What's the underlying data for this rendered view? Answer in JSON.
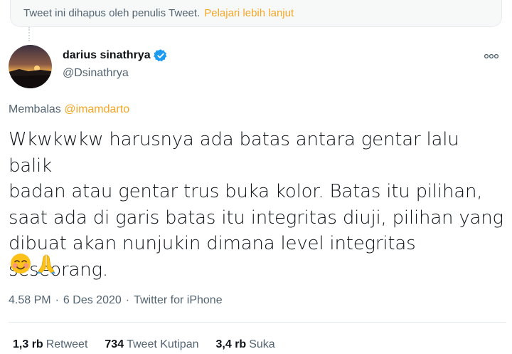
{
  "banner": {
    "text": "Tweet ini dihapus oleh penulis Tweet.",
    "link": "Pelajari lebih lanjut"
  },
  "author": {
    "name": "darius sinathrya",
    "handle": "@Dsinathrya"
  },
  "reply": {
    "prefix": "Membalas",
    "mention": "@imamdarto"
  },
  "tweet": {
    "lines": [
      "Wkwkwkw harusnya ada batas antara gentar lalu balik",
      "badan atau gentar trus buka kolor. Batas itu pilihan,",
      "saat ada di garis batas itu integritas diuji, pilihan yang",
      "dibuat akan nunjukin dimana level integritas seseorang."
    ],
    "emojis": [
      "smiling-face-with-blush-icon",
      "folded-hands-icon"
    ]
  },
  "meta": {
    "time": "4.58 PM",
    "sep1": "·",
    "date": "6 Des 2020",
    "sep2": "·",
    "source": "Twitter for iPhone"
  },
  "stats": {
    "retweets_count": "1,3 rb",
    "retweets_label": "Retweet",
    "quotes_count": "734",
    "quotes_label": "Tweet Kutipan",
    "likes_count": "3,4 rb",
    "likes_label": "Suka"
  },
  "colors": {
    "accent": "#f5a623",
    "verified": "#1d9bf0",
    "muted": "#536471"
  }
}
